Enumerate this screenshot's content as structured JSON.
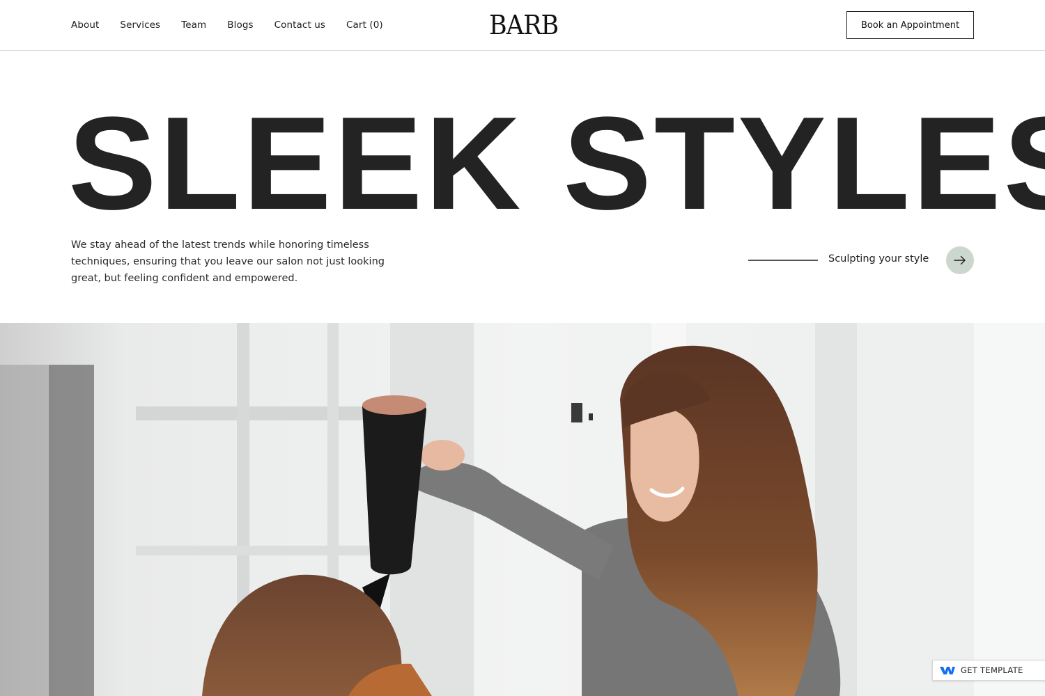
{
  "nav": {
    "items": [
      {
        "label": "About"
      },
      {
        "label": "Services"
      },
      {
        "label": "Team"
      },
      {
        "label": "Blogs"
      },
      {
        "label": "Contact us"
      },
      {
        "label": "Cart (0)"
      }
    ]
  },
  "brand": {
    "logo": "BARB"
  },
  "header": {
    "cta_label": "Book an Appointment"
  },
  "hero": {
    "title": "SLEEK STYLES",
    "description": "We stay ahead of the latest trends while honoring timeless techniques, ensuring that you leave our salon not just looking great, but feeling confident and empowered.",
    "tagline": "Sculpting your style"
  },
  "badge": {
    "label": "GET TEMPLATE"
  },
  "icons": {
    "arrow": "arrow-right-icon",
    "badge": "webflow-logo-icon"
  },
  "colors": {
    "text": "#1d1d1d",
    "arrow_button": "#cbd7cf",
    "badge_logo": "#146ef5"
  }
}
